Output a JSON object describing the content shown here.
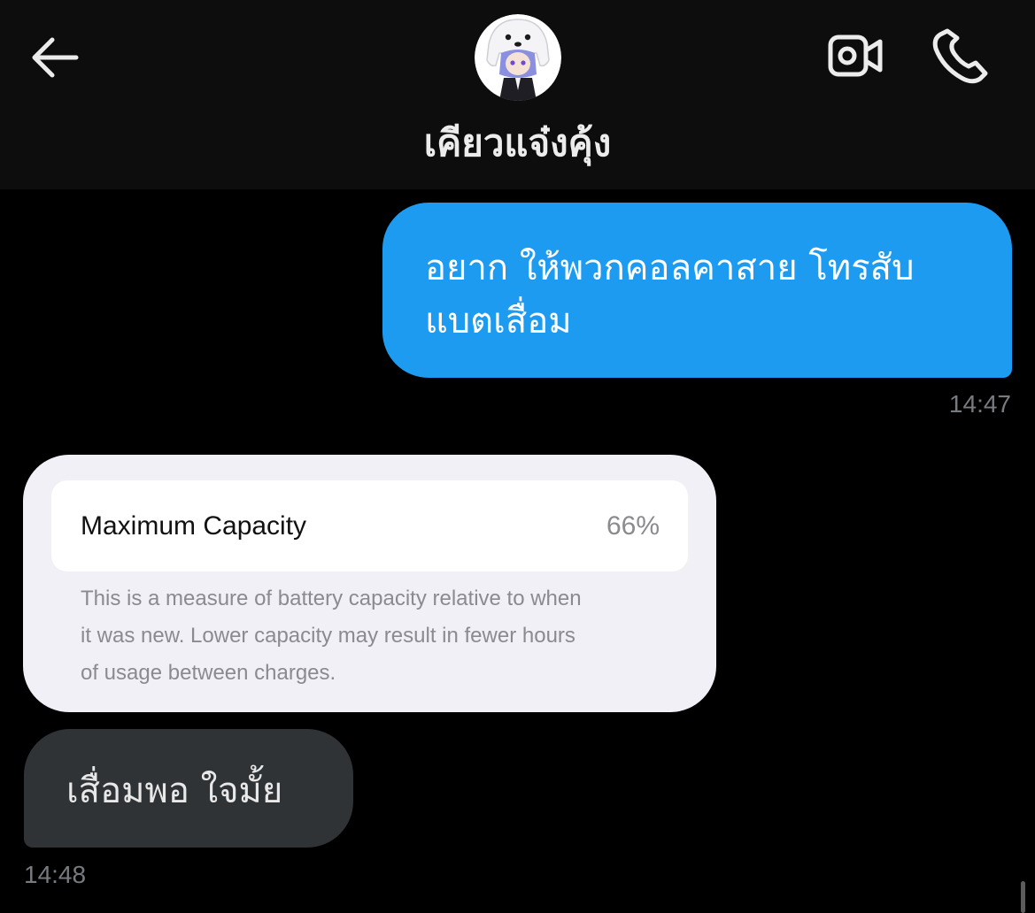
{
  "header": {
    "contact_name": "เคียวแจ๋งคุ้ง",
    "back_icon": "arrow-left-icon",
    "video_icon": "video-camera-icon",
    "call_icon": "phone-icon"
  },
  "messages": {
    "outgoing_1": {
      "lines": [
        "อยาก ให้พวกคอลคาสาย โทรสับ",
        "แบตเสื่อม"
      ],
      "time": "14:47"
    },
    "incoming_image": {
      "label": "Maximum Capacity",
      "value": "66%",
      "description_lines": [
        "This is a measure of battery capacity relative to when",
        "it was new. Lower capacity may result in fewer hours",
        "of usage between charges."
      ]
    },
    "incoming_1": {
      "text": "เสื่อมพอ ใจมั้ย",
      "time": "14:48"
    }
  },
  "colors": {
    "outgoing_bubble": "#1d9bf0",
    "incoming_bubble": "#2f3336",
    "background": "#000000",
    "timestamp": "#777b80"
  }
}
